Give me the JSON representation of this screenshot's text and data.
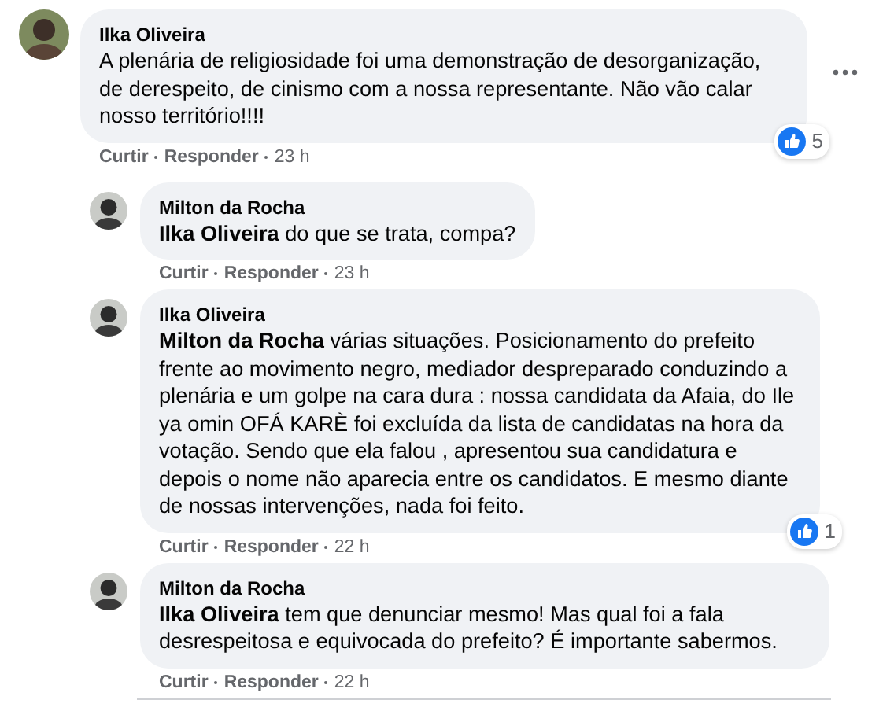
{
  "comments": [
    {
      "author": "Ilka Oliveira",
      "text": "A plenária de religiosidade foi uma demonstração de desorganização, de derespeito, de cinismo com a nossa representante. Não vão calar nosso território!!!!",
      "actions": [
        "Curtir",
        "Responder"
      ],
      "time": "23 h",
      "reactions": "5",
      "more_menu": true,
      "replies": [
        {
          "author": "Milton da Rocha",
          "text": "**Ilka Oliveira** do que se trata, compa?",
          "actions": [
            "Curtir",
            "Responder"
          ],
          "time": "23 h"
        },
        {
          "author": "Ilka Oliveira",
          "text": "**Milton da Rocha** várias situações. Posicionamento do prefeito frente ao movimento negro, mediador despreparado conduzindo a plenária e um golpe na cara dura : nossa candidata da Afaia, do Ile ya omin OFÁ KARÈ foi excluída da lista de candidatas na hora da votação. Sendo que ela falou , apresentou sua candidatura e depois o nome não aparecia entre os candidatos. E mesmo diante de nossas intervenções, nada foi feito.",
          "actions": [
            "Curtir",
            "Responder"
          ],
          "time": "22 h",
          "reactions": "1"
        },
        {
          "author": "Milton da Rocha",
          "text": "**Ilka Oliveira** tem que denunciar mesmo! Mas qual foi a fala desrespeitosa e equivocada do prefeito? É importante sabermos.",
          "actions": [
            "Curtir",
            "Responder"
          ],
          "time": "22 h"
        }
      ]
    }
  ]
}
